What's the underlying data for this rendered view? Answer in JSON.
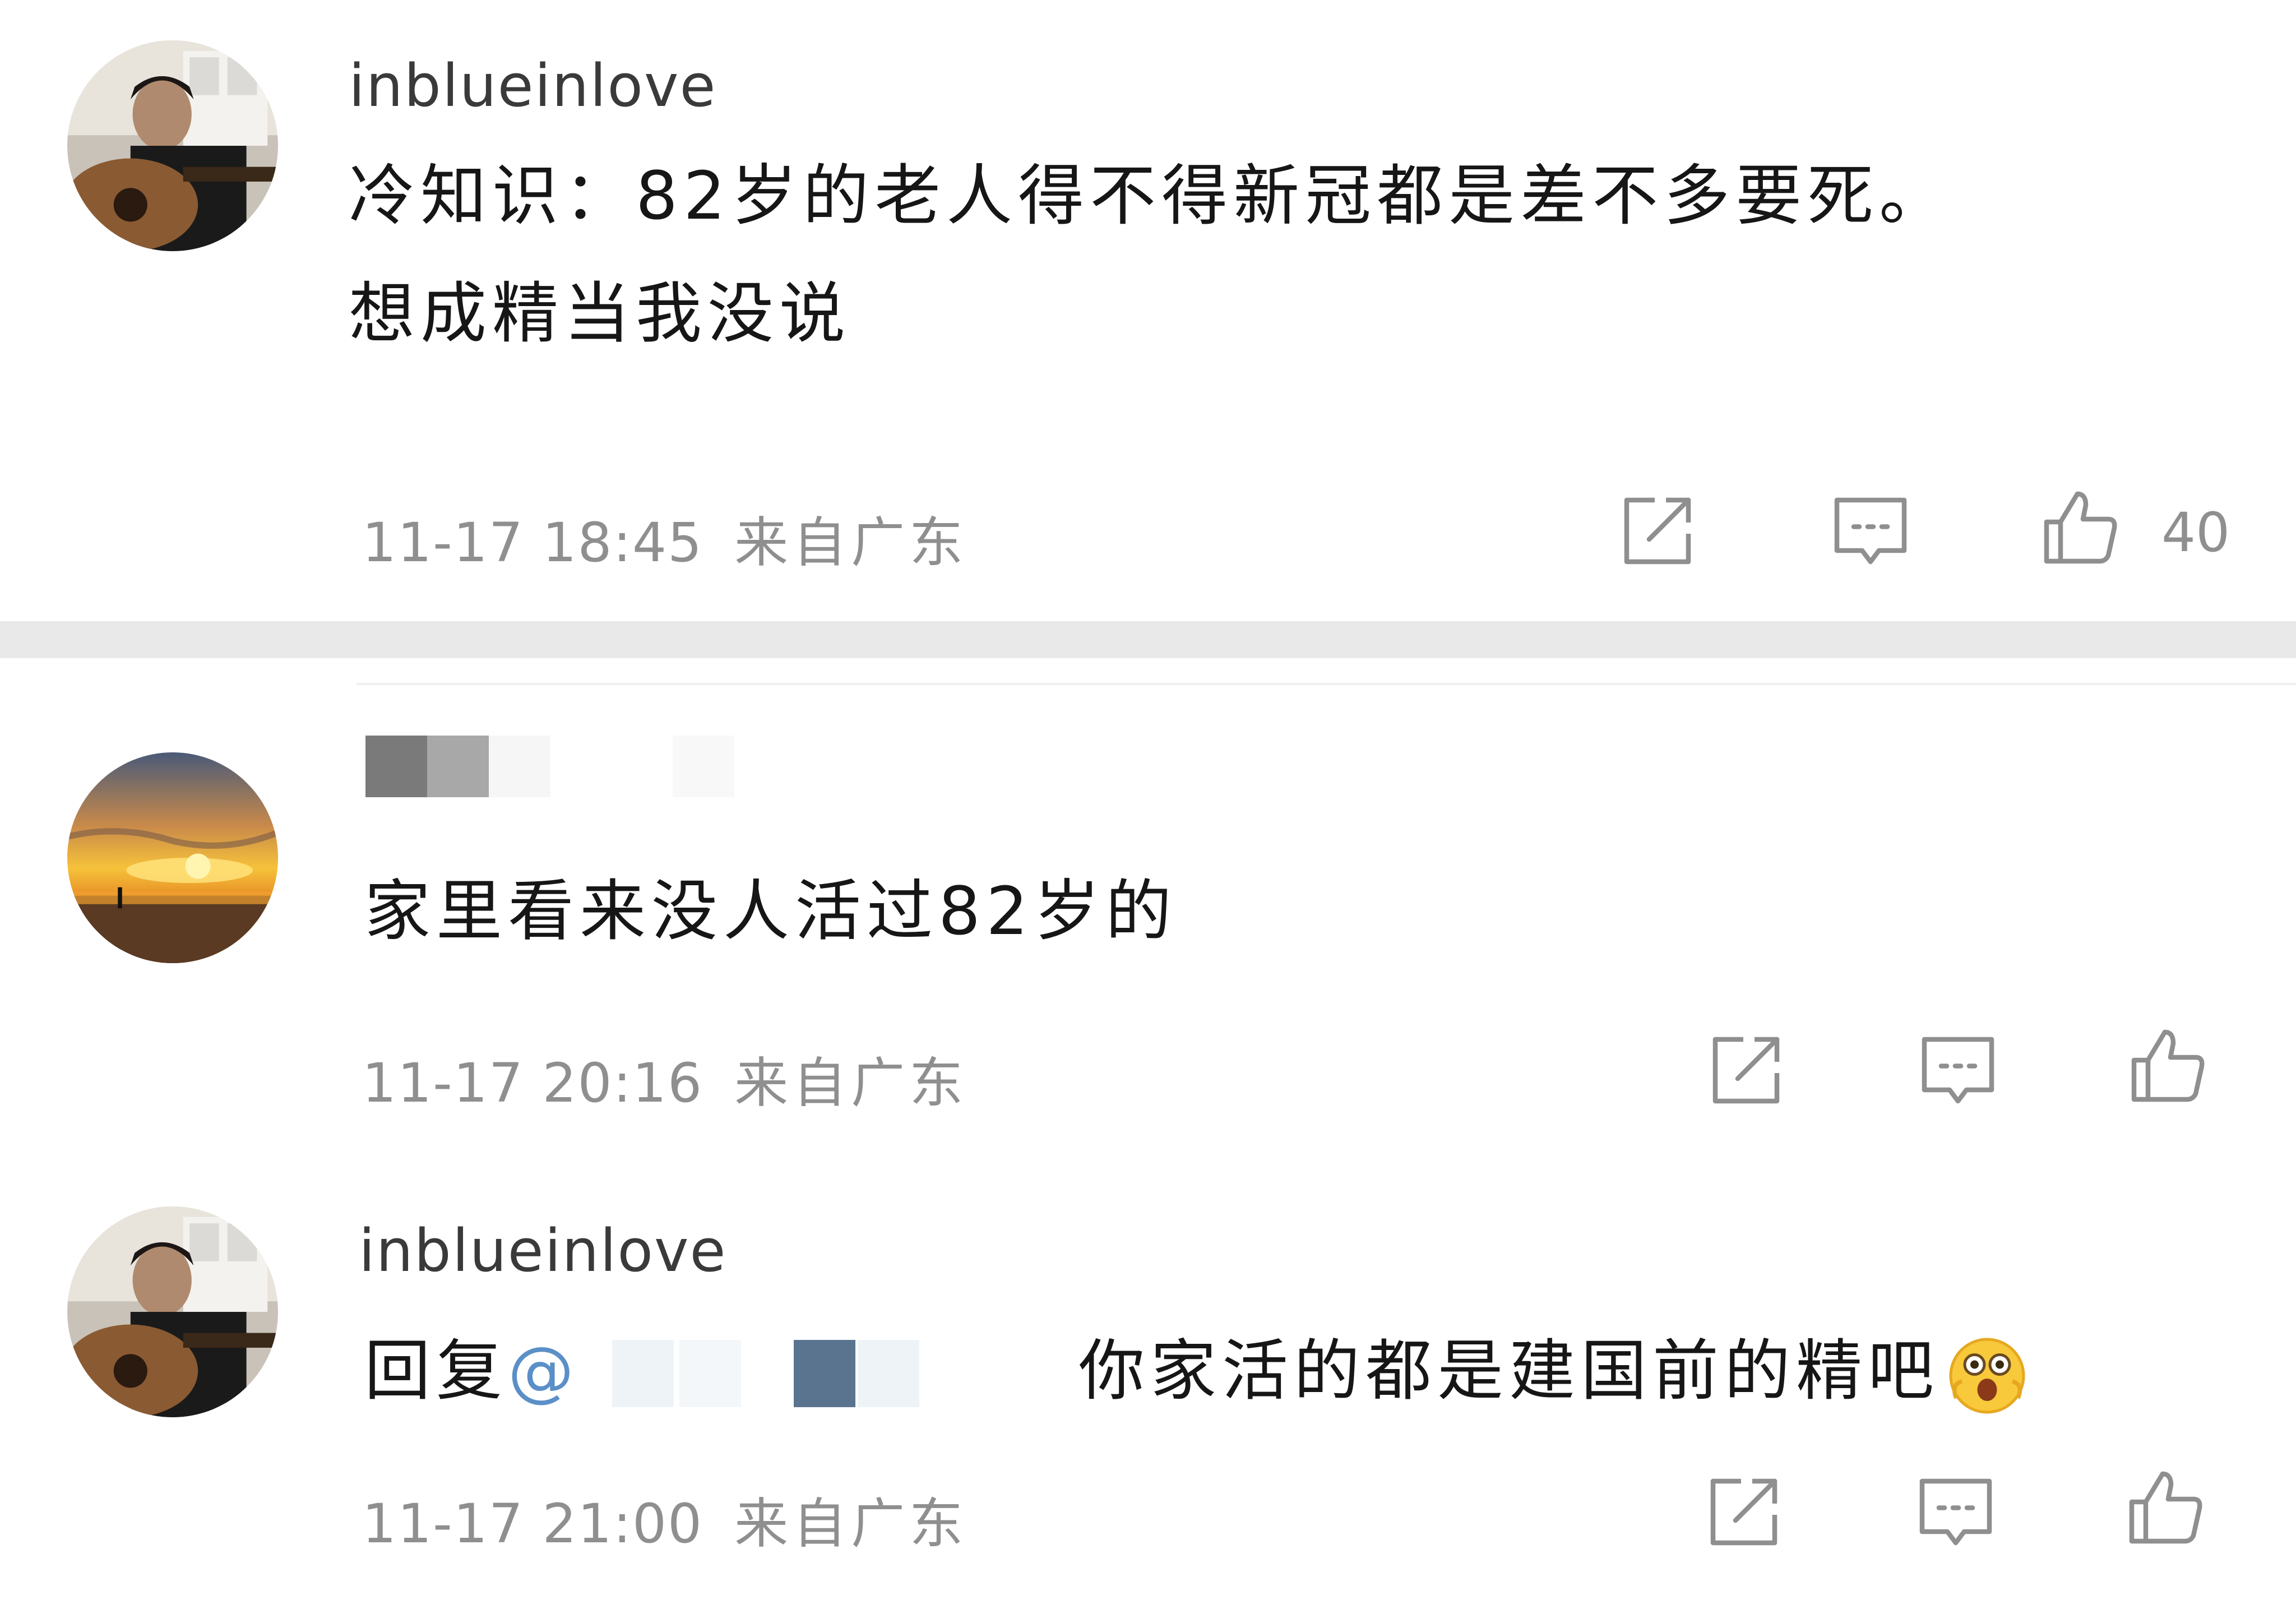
{
  "comments": [
    {
      "username": "inblueinlove",
      "lines": [
        "冷知识：82岁的老人得不得新冠都是差不多要死。",
        "想成精当我没说"
      ],
      "time": "11-17 18:45",
      "location": "来自广东",
      "like_count": "40"
    },
    {
      "username": "",
      "lines": [
        "家里看来没人活过82岁的"
      ],
      "time": "11-17 20:16",
      "location": "来自广东",
      "like_count": ""
    },
    {
      "username": "inblueinlove",
      "reply_prefix": "回复",
      "mention": "@",
      "text": "你家活的都是建国前的精吧",
      "time": "11-17 21:00",
      "location": "来自广东",
      "like_count": ""
    }
  ],
  "icons": {
    "share": "share-icon",
    "reply": "comment-icon",
    "like": "thumbs-up-icon",
    "emoji": "shocked-face-emoji"
  },
  "colors": {
    "meta_text": "#8f8f8f",
    "mention": "#5b8fc7",
    "divider": "#e9e9e9"
  }
}
